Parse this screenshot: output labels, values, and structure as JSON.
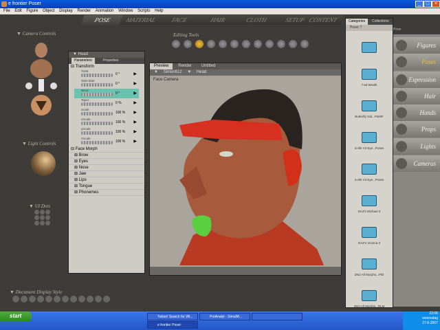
{
  "window": {
    "title": "e frontier Poser"
  },
  "menu": [
    "File",
    "Edit",
    "Figure",
    "Object",
    "Display",
    "Render",
    "Animation",
    "Window",
    "Scripts",
    "Help"
  ],
  "room_tabs": [
    {
      "label": "POSE",
      "active": true
    },
    {
      "label": "MATERIAL",
      "active": false
    },
    {
      "label": "FACE",
      "active": false
    },
    {
      "label": "HAIR",
      "active": false
    },
    {
      "label": "CLOTH",
      "active": false
    },
    {
      "label": "SETUP",
      "active": false
    },
    {
      "label": "CONTENT",
      "active": false
    }
  ],
  "left_panel": {
    "camera_controls": "Camera Controls",
    "light_controls": "Light Controls",
    "ui_dots": "UI Dots",
    "document_display_style": "Document Display Style"
  },
  "editing_tools": {
    "label": "Editing Tools",
    "icons": [
      "rotate-icon",
      "twist-icon",
      "translate-icon",
      "move-icon",
      "scale-icon",
      "taper-icon",
      "chain-break-icon",
      "color-icon",
      "grouping-icon",
      "view-magnifier-icon",
      "morph-brush-icon",
      "direct-manipulation-icon"
    ]
  },
  "params": {
    "title": "Head",
    "tabs": [
      {
        "label": "Parameters",
        "active": true
      },
      {
        "label": "Properties",
        "active": false
      }
    ],
    "group_transform": "Transform",
    "dials": [
      {
        "name": "Twist",
        "value": "0 °",
        "selected": false
      },
      {
        "name": "Side-Side",
        "value": "0 °",
        "selected": false
      },
      {
        "name": "Bend",
        "value": "0 °",
        "selected": true
      },
      {
        "name": "Taper",
        "value": "0 %",
        "selected": false
      },
      {
        "name": "Scale",
        "value": "100 %",
        "selected": false
      },
      {
        "name": "xScale",
        "value": "100 %",
        "selected": false
      },
      {
        "name": "yScale",
        "value": "100 %",
        "selected": false
      },
      {
        "name": "zScale",
        "value": "100 %",
        "selected": false
      }
    ],
    "group_morph": "Face Morph",
    "morphs": [
      "Brow",
      "Eyes",
      "Nose",
      "Jaw",
      "Lips",
      "Tongue",
      "Phonemes"
    ]
  },
  "viewport": {
    "tabs": [
      {
        "label": "Preview",
        "active": true
      },
      {
        "label": "Render",
        "active": false
      },
      {
        "label": "Untitled",
        "active": false
      }
    ],
    "figure_select": "Simon612",
    "part_select": "Head",
    "camera_label": "Face Camera"
  },
  "library": {
    "tabs": [
      {
        "label": "Categories",
        "active": true
      },
      {
        "label": "Collections",
        "active": false
      }
    ],
    "subheader": "Poser 7",
    "subheader_right": "Pose",
    "items": [
      "7.5d Wraith",
      "Butterfly Gal...F600F",
      "3.elle V3 Eye...Poses",
      "3.elle V3 Eye...Poses",
      "DAZ's Michael 3",
      "DAZ's Victoria 3",
      "2NO All Morphs...Phil",
      "2NO All Morphs...RLM"
    ]
  },
  "categories": [
    {
      "label": "Figures",
      "active": false
    },
    {
      "label": "Poses",
      "active": true
    },
    {
      "label": "Expression",
      "active": false
    },
    {
      "label": "Hair",
      "active": false
    },
    {
      "label": "Hands",
      "active": false
    },
    {
      "label": "Props",
      "active": false
    },
    {
      "label": "Lights",
      "active": false
    },
    {
      "label": "Cameras",
      "active": false
    }
  ],
  "taskbar": {
    "start": "start",
    "tasks": [
      {
        "label": "Yahoo! Search for Wi...",
        "active": false
      },
      {
        "label": "ProAnalyt - SimulM...",
        "active": false
      },
      {
        "label": "",
        "active": false
      },
      {
        "label": "e frontier Poser",
        "active": true
      }
    ],
    "clock": "22:06",
    "day": "woensdag",
    "date": "27-6-2007"
  },
  "colors": {
    "accent_active_dial": "#6cc2b0",
    "active_category": "#f0c040",
    "titlebar": "#0a5adc"
  }
}
